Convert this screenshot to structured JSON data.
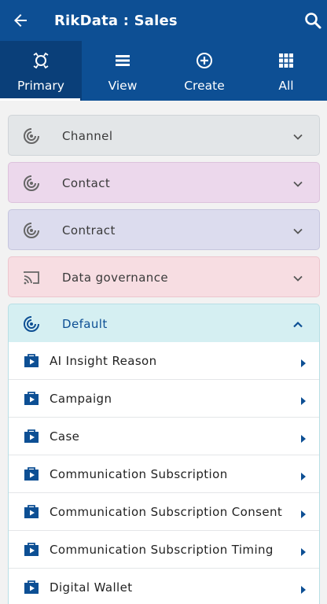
{
  "header": {
    "title": "RikData : Sales",
    "back_icon": "arrow-left-icon",
    "search_icon": "search-icon",
    "background": "#0d4f94"
  },
  "tabs": [
    {
      "label": "Primary",
      "icon": "primary-icon",
      "active": true
    },
    {
      "label": "View",
      "icon": "list-icon",
      "active": false
    },
    {
      "label": "Create",
      "icon": "plus-circle-icon",
      "active": false
    },
    {
      "label": "All",
      "icon": "grid-icon",
      "active": false
    }
  ],
  "sections": [
    {
      "label": "Channel",
      "icon": "radar-icon",
      "expanded": false,
      "color": "#e3e6e8"
    },
    {
      "label": "Contact",
      "icon": "radar-icon",
      "expanded": false,
      "color": "#ecd8ec"
    },
    {
      "label": "Contract",
      "icon": "radar-icon",
      "expanded": false,
      "color": "#dcdcee"
    },
    {
      "label": "Data governance",
      "icon": "cast-icon",
      "expanded": false,
      "color": "#f7dde2"
    },
    {
      "label": "Default",
      "icon": "radar-icon",
      "expanded": true,
      "color": "#d5eff2"
    }
  ],
  "default_items": [
    {
      "label": "AI Insight Reason",
      "icon": "video-folder-icon"
    },
    {
      "label": "Campaign",
      "icon": "video-folder-icon"
    },
    {
      "label": "Case",
      "icon": "video-folder-icon"
    },
    {
      "label": "Communication Subscription",
      "icon": "video-folder-icon"
    },
    {
      "label": "Communication Subscription Consent",
      "icon": "video-folder-icon"
    },
    {
      "label": "Communication Subscription Timing",
      "icon": "video-folder-icon"
    },
    {
      "label": "Digital Wallet",
      "icon": "video-folder-icon"
    }
  ],
  "colors": {
    "accent": "#0d4f94",
    "tab_active": "#0a3f79"
  }
}
